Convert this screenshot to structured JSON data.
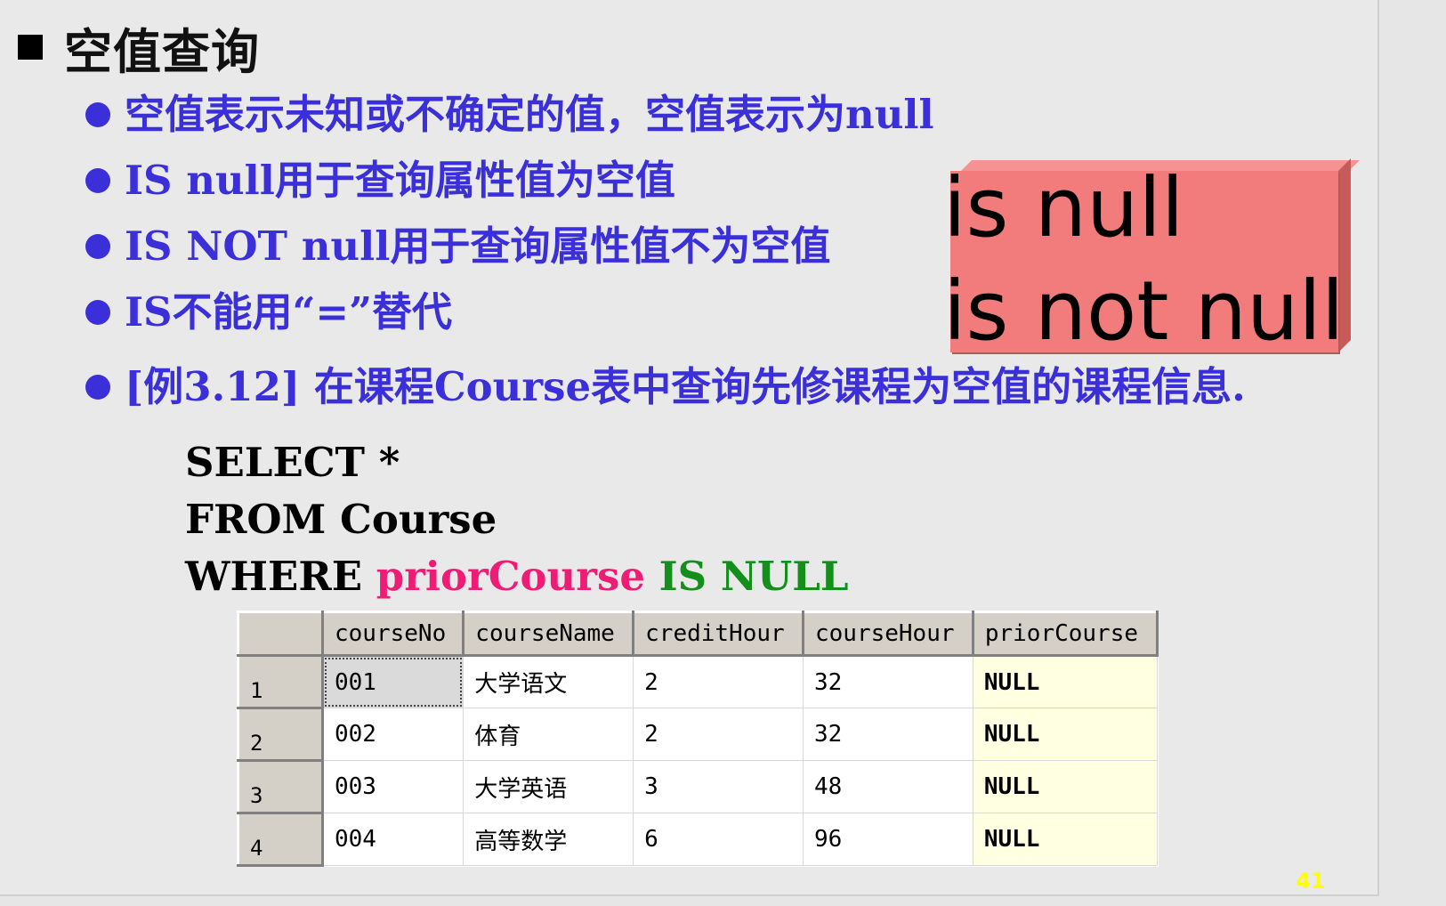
{
  "title": "空值查询",
  "bullets": [
    "空值表示未知或不确定的值，空值表示为null",
    "IS null用于查询属性值为空值",
    "IS NOT null用于查询属性值不为空值",
    "IS不能用“=”替代",
    "[例3.12] 在课程Course表中查询先修课程为空值的课程信息."
  ],
  "callout": {
    "line1": "is null",
    "line2": "is not null",
    "fill_color": "#f27b7b"
  },
  "sql": {
    "line1": "SELECT *",
    "line2": "FROM Course",
    "line3_keyword": "WHERE",
    "line3_column": "priorCourse",
    "line3_predicate": "IS NULL",
    "column_color": "#ee1c74",
    "predicate_color": "#148f1c"
  },
  "result_grid": {
    "columns": [
      "courseNo",
      "courseName",
      "creditHour",
      "courseHour",
      "priorCourse"
    ],
    "rows": [
      {
        "num": "1",
        "cells": [
          "001",
          "大学语文",
          "2",
          "32",
          "NULL"
        ]
      },
      {
        "num": "2",
        "cells": [
          "002",
          "体育",
          "2",
          "32",
          "NULL"
        ]
      },
      {
        "num": "3",
        "cells": [
          "003",
          "大学英语",
          "3",
          "48",
          "NULL"
        ]
      },
      {
        "num": "4",
        "cells": [
          "004",
          "高等数学",
          "6",
          "96",
          "NULL"
        ]
      }
    ]
  },
  "page_number": "41",
  "colors": {
    "bullet_blue": "#3a2fd8",
    "page_number": "#ffff00"
  }
}
